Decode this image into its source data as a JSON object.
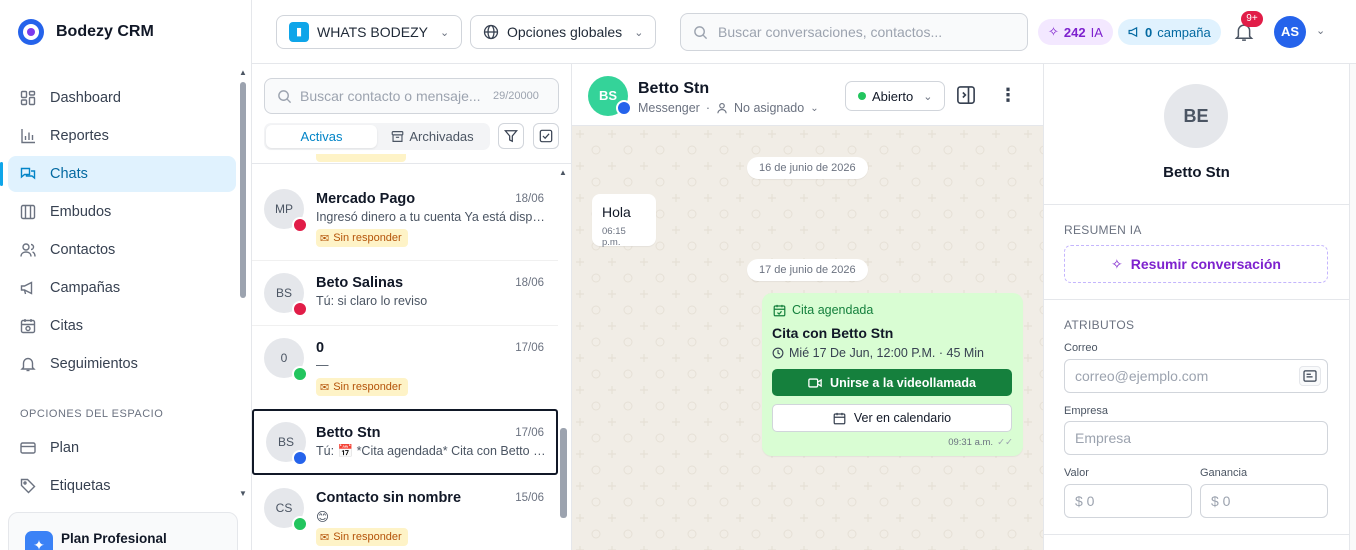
{
  "app": {
    "name": "Bodezy CRM"
  },
  "sidebar": {
    "items": [
      {
        "label": "Dashboard",
        "icon": "dashboard-icon"
      },
      {
        "label": "Reportes",
        "icon": "bar-chart-icon"
      },
      {
        "label": "Chats",
        "icon": "chat-icon",
        "active": true
      },
      {
        "label": "Embudos",
        "icon": "kanban-icon"
      },
      {
        "label": "Contactos",
        "icon": "users-icon"
      },
      {
        "label": "Campañas",
        "icon": "megaphone-icon"
      },
      {
        "label": "Citas",
        "icon": "calendar-icon"
      },
      {
        "label": "Seguimientos",
        "icon": "bell-icon"
      }
    ],
    "workspace_section": "OPCIONES DEL ESPACIO",
    "workspace_items": [
      {
        "label": "Plan",
        "icon": "card-icon"
      },
      {
        "label": "Etiquetas",
        "icon": "tag-icon"
      }
    ],
    "plan_card": {
      "label": "Plan Profesional"
    }
  },
  "topbar": {
    "inbox": "WHATS BODEZY",
    "global_options": "Opciones globales",
    "search_placeholder": "Buscar conversaciones, contactos...",
    "ai_count": "242",
    "ai_label": "IA",
    "campaign_count": "0",
    "campaign_label": "campaña",
    "notif_badge": "9+",
    "user_initials": "AS"
  },
  "conv_list": {
    "search_placeholder": "Buscar contacto o mensaje...",
    "counter": "29/20000",
    "tabs": {
      "active": "Activas",
      "archived": "Archivadas"
    },
    "items": [
      {
        "initials": "MP",
        "name": "Mercado Pago",
        "date": "18/06",
        "snippet": "Ingresó dinero a tu cuenta Ya está disponible",
        "channel": "mail",
        "badge": "Sin responder"
      },
      {
        "initials": "BS",
        "name": "Beto Salinas",
        "date": "18/06",
        "snippet": "Tú: si claro lo reviso",
        "channel": "mail",
        "badge": ""
      },
      {
        "initials": "0",
        "name": "0",
        "date": "17/06",
        "snippet": "—",
        "channel": "whatsapp",
        "badge": "Sin responder"
      },
      {
        "initials": "BS",
        "name": "Betto Stn",
        "date": "17/06",
        "snippet": "Tú: 📅 *Cita agendada* Cita con Betto Stn",
        "channel": "messenger",
        "badge": "",
        "selected": true
      },
      {
        "initials": "CS",
        "name": "Contacto sin nombre",
        "date": "15/06",
        "snippet": "😊",
        "channel": "whatsapp",
        "badge": "Sin responder"
      }
    ]
  },
  "chat": {
    "contact_initials": "BS",
    "contact_name": "Betto Stn",
    "channel": "Messenger",
    "assignee": "No asignado",
    "status": "Abierto",
    "messages": [
      {
        "date_divider": "16 de junio de 2026"
      },
      {
        "text": "Hola",
        "time": "06:15 p.m."
      },
      {
        "date_divider": "17 de junio de 2026"
      }
    ],
    "appointment": {
      "header": "Cita agendada",
      "title": "Cita con Betto Stn",
      "when": "Mié 17 De Jun, 12:00 P.M. · 45 Min",
      "join_label": "Unirse a la videollamada",
      "calendar_label": "Ver en calendario",
      "time": "09:31 a.m."
    }
  },
  "details": {
    "initials": "BE",
    "name": "Betto Stn",
    "ai_summary_title": "RESUMEN IA",
    "summarize_label": "Resumir conversación",
    "attributes_title": "ATRIBUTOS",
    "email_label": "Correo",
    "email_placeholder": "correo@ejemplo.com",
    "company_label": "Empresa",
    "company_placeholder": "Empresa",
    "value_label": "Valor",
    "value_placeholder": "$ 0",
    "profit_label": "Ganancia",
    "profit_placeholder": "$ 0"
  },
  "colors": {
    "accent": "#0ea5e9",
    "ai_purple": "#7e22ce",
    "chat_background": "#f1ede6",
    "outgoing_bubble": "#d9fdd3",
    "join_button": "#15803d",
    "unanswered_badge": "#fef3c7"
  }
}
